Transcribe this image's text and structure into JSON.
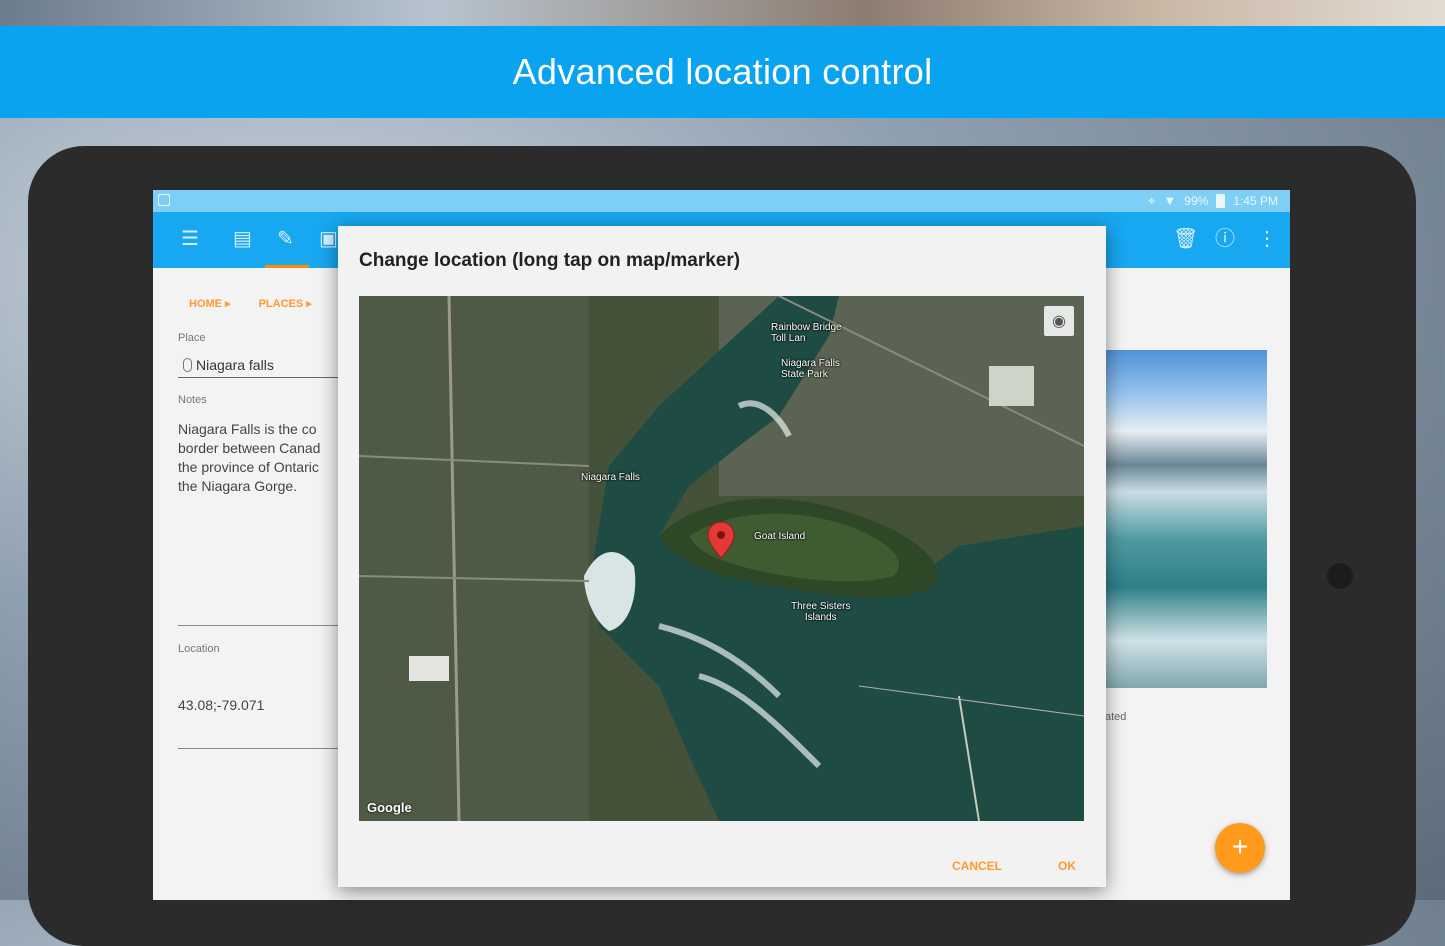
{
  "banner": {
    "title": "Advanced location control"
  },
  "statusbar": {
    "battery": "99%",
    "time": "1:45 PM"
  },
  "breadcrumbs": [
    "HOME ▸",
    "PLACES ▸"
  ],
  "form": {
    "place_label": "Place",
    "place_value": "Niagara falls",
    "notes_label": "Notes",
    "notes_value": "Niagara Falls is the co\nborder between Canad\nthe province of Ontaric\nthe Niagara Gorge.",
    "location_label": "Location",
    "location_value": "43.08;-79.071"
  },
  "photo": {
    "caption_fragment": "ated"
  },
  "fab": {
    "label": "+"
  },
  "dialog": {
    "title": "Change location (long tap on map/marker)",
    "cancel_label": "CANCEL",
    "ok_label": "OK",
    "map": {
      "attribution": "Google",
      "labels": {
        "niagara_falls": "Niagara Falls",
        "goat_island": "Goat Island",
        "three_sisters": "Three Sisters\nIslands",
        "rainbow_bridge": "Rainbow Bridge\nToll Lan",
        "niagara_falls_state_park": "Niagara Falls\nState Park"
      }
    }
  },
  "icons": {
    "menu": "menu-icon",
    "list": "list-icon",
    "edit": "edit-icon",
    "image": "image-icon",
    "delete": "delete-icon",
    "info": "info-icon",
    "more": "more-vert-icon",
    "location": "location-pin-icon",
    "wifi": "wifi-icon",
    "center": "my-location-icon"
  },
  "colors": {
    "banner": "#0aa3ef",
    "appbar": "#18a7f1",
    "accent": "#ff9a2e",
    "marker": "#e53935"
  }
}
